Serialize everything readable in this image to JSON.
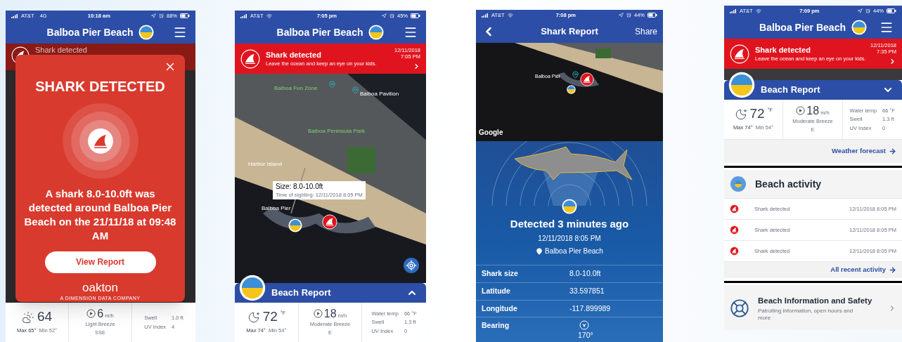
{
  "phones": [
    {
      "kind": "alert",
      "status": {
        "carrier": "AT&T",
        "network": "4G",
        "time": "10:18 am",
        "battery": "88%"
      },
      "header": {
        "title": "Balboa Pier Beach"
      },
      "banner": {
        "title": "Shark detected"
      },
      "weather": {
        "kind": "cloudy",
        "temp": "64",
        "max": "Max 65°",
        "min": "Min 52°",
        "wind": "6",
        "wind_unit": "m/h",
        "wind_desc": "Light Breeze",
        "wind_dir": "SSE",
        "conditions": [
          {
            "label": "Swell",
            "value": "1.0 ft"
          },
          {
            "label": "UV Index",
            "value": "4"
          }
        ]
      },
      "modal": {
        "title": "SHARK DETECTED",
        "message": "A shark 8.0-10.0ft was detected around Balboa Pier Beach on the 21/11/18 at 09:48 AM",
        "button": "View Report",
        "brand": "oakton",
        "tagline": "A DIMENSION DATA COMPANY"
      }
    },
    {
      "kind": "map",
      "status": {
        "carrier": "AT&T",
        "time": "7:05 pm",
        "battery": "45%"
      },
      "header": {
        "title": "Balboa Pier Beach"
      },
      "banner": {
        "title": "Shark detected",
        "message": "Leave the ocean and keep an eye on your kids.",
        "date": "12/11/2018",
        "time": "7:05 PM"
      },
      "map": {
        "labels": [
          {
            "text": "Balboa Fun Zone",
            "kind": "park"
          },
          {
            "text": "Balboa Pavilion",
            "kind": "plain"
          },
          {
            "text": "Balboa Peninsula Park",
            "kind": "park"
          },
          {
            "text": "Harbor Island",
            "kind": "plain"
          },
          {
            "text": "Balboa Pier",
            "kind": "plain"
          }
        ],
        "popup": {
          "size": "Size: 8.0-10.0ft",
          "time": "Time of sighting: 12/11/2018 8:05 PM"
        }
      },
      "report_bar": {
        "title": "Beach Report",
        "expanded": false
      },
      "weather": {
        "kind": "night",
        "temp": "72",
        "temp_unit": "°F",
        "max": "Max 74°",
        "min": "Min 54°",
        "wind": "18",
        "wind_unit": "m/h",
        "wind_desc": "Moderate Breeze",
        "wind_dir": "E",
        "conditions": [
          {
            "label": "Water temp",
            "value": "66 °F"
          },
          {
            "label": "Swell",
            "value": "1.3 ft"
          },
          {
            "label": "UV Index",
            "value": "0"
          }
        ]
      }
    },
    {
      "kind": "report",
      "status": {
        "carrier": "AT&T",
        "time": "7:08 pm",
        "battery": "44%"
      },
      "nav": {
        "title": "Shark Report",
        "action": "Share"
      },
      "map": {
        "label": "Balboa Pier",
        "attribution": "Google"
      },
      "detection": {
        "headline": "Detected 3 minutes ago",
        "datetime": "12/11/2018 8:05 PM",
        "location": "Balboa Pier Beach"
      },
      "rows": [
        {
          "label": "Shark size",
          "value": "8.0-10.0ft",
          "kind": "text"
        },
        {
          "label": "Latitude",
          "value": "33.597851",
          "kind": "text"
        },
        {
          "label": "Longitude",
          "value": "-117.899989",
          "kind": "text"
        },
        {
          "label": "Bearing",
          "value": "170°",
          "kind": "bearing"
        }
      ]
    },
    {
      "kind": "overview",
      "status": {
        "carrier": "AT&T",
        "time": "7:09 pm",
        "battery": "44%"
      },
      "header": {
        "title": "Balboa Pier Beach"
      },
      "banner": {
        "title": "Shark detected",
        "message": "Leave the ocean and keep an eye on your kids.",
        "date": "12/11/2018",
        "time": "7:35 PM"
      },
      "report_bar": {
        "title": "Beach Report",
        "expanded": true
      },
      "weather": {
        "kind": "night",
        "temp": "72",
        "temp_unit": "°F",
        "max": "Max 74°",
        "min": "Min 54°",
        "wind": "18",
        "wind_unit": "m/h",
        "wind_desc": "Moderate Breeze",
        "wind_dir": "E",
        "conditions": [
          {
            "label": "Water temp",
            "value": "66 °F"
          },
          {
            "label": "Swell",
            "value": "1.3 ft"
          },
          {
            "label": "UV Index",
            "value": "0"
          }
        ]
      },
      "forecast_link": "Weather forecast",
      "activity": {
        "title": "Beach activity",
        "items": [
          {
            "label": "Shark detected",
            "time": "12/11/2018 8:05 PM"
          },
          {
            "label": "Shark detected",
            "time": "12/11/2018 8:05 PM"
          },
          {
            "label": "Shark detected",
            "time": "12/11/2018 8:05 PM"
          }
        ],
        "link": "All recent activity"
      },
      "info": {
        "title": "Beach Information and Safety",
        "subtitle": "Patrolling information, open hours and more"
      }
    }
  ]
}
